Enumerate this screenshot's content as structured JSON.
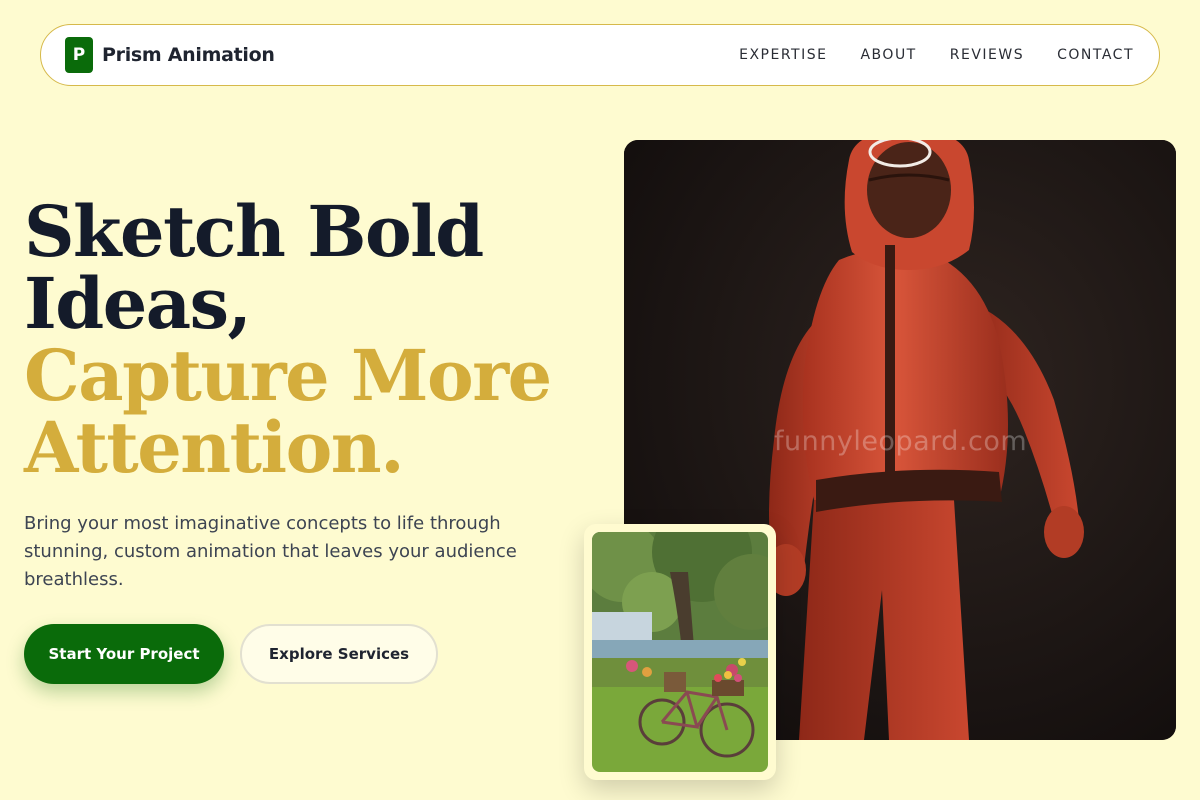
{
  "nav": {
    "brand_initial": "P",
    "brand_name": "Prism Animation",
    "links": [
      "EXPERTISE",
      "ABOUT",
      "REVIEWS",
      "CONTACT"
    ]
  },
  "hero": {
    "headline_line1": "Sketch Bold",
    "headline_line2": "Ideas,",
    "headline_line3": "Capture More",
    "headline_line4": "Attention.",
    "subcopy": "Bring your most imaginative concepts to life through stunning, custom animation that leaves your audience breathless.",
    "primary_cta": "Start Your Project",
    "secondary_cta": "Explore Services",
    "image_watermark": "funnyleopard.com"
  },
  "colors": {
    "background": "#fefbd0",
    "brand_green": "#0a6b0a",
    "accent_gold": "#d4ad3c",
    "heading_dark": "#141b2a"
  },
  "images": {
    "main": "red-jumpsuit-masked-figure-illustration",
    "secondary": "bicycle-with-flower-basket-by-river-photo"
  }
}
